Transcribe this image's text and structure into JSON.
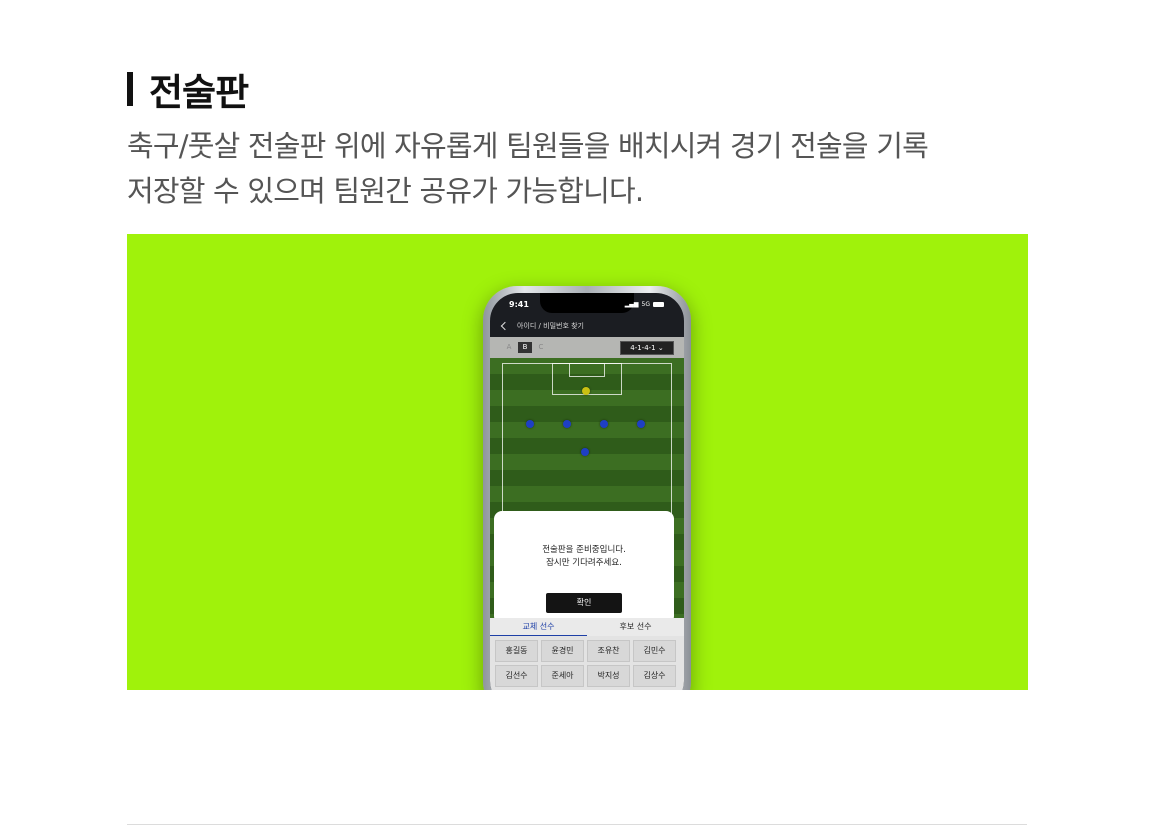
{
  "section": {
    "title": "전술판",
    "description_line1": "축구/풋살 전술판 위에 자유롭게 팀원들을 배치시켜 경기 전술을 기록",
    "description_line2": "저장할 수 있으며 팀원간 공유가 가능합니다."
  },
  "banner_color": "#a0f20b",
  "phone": {
    "status_time": "9:41",
    "network": "5G",
    "nav_title": "아이디 / 비밀번호 찾기",
    "lineup_tabs": [
      "A",
      "B",
      "C"
    ],
    "active_lineup": "B",
    "formation": "4-1-4-1",
    "dialog": {
      "line1": "전술판을 준비중입니다.",
      "line2": "잠시만 기다려주세요.",
      "confirm": "확인"
    },
    "subs_tabs": [
      "교체 선수",
      "후보 선수"
    ],
    "active_subs_tab": "교체 선수",
    "players": [
      "홍길동",
      "윤경민",
      "조유찬",
      "김민수",
      "김선수",
      "준세아",
      "박지성",
      "김상수"
    ]
  }
}
